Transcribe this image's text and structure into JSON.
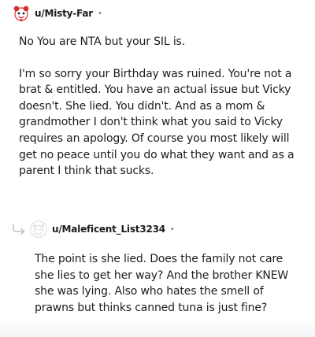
{
  "comments": [
    {
      "username": "u/Misty-Far",
      "separator": "•",
      "paragraphs": [
        "No You are NTA but your SIL is.",
        "I'm so sorry your Birthday was ruined. You're not a brat & entitled. You have an actual issue but Vicky doesn't. She lied. You didn't. And as a mom & grandmother I don't think what you said to Vicky requires an apology. Of course you most likely will get no peace until you do what they want and as a parent I think that sucks."
      ]
    },
    {
      "username": "u/Maleficent_List3234",
      "separator": "•",
      "paragraphs": [
        "The point is she lied. Does the family not care she lies to get her way? And the brother KNEW she was lying. Also who hates the smell of prawns but thinks canned tuna is just fine?"
      ]
    }
  ],
  "icons": {
    "comment1_avatar": "snoo-avatar-icon",
    "reply": "reply-arrow-icon",
    "comment2_avatar": "default-avatar-icon"
  },
  "colors": {
    "text": "#1c1c1c",
    "muted": "#7c7c7c",
    "avatar_red": "#d92b2b"
  }
}
